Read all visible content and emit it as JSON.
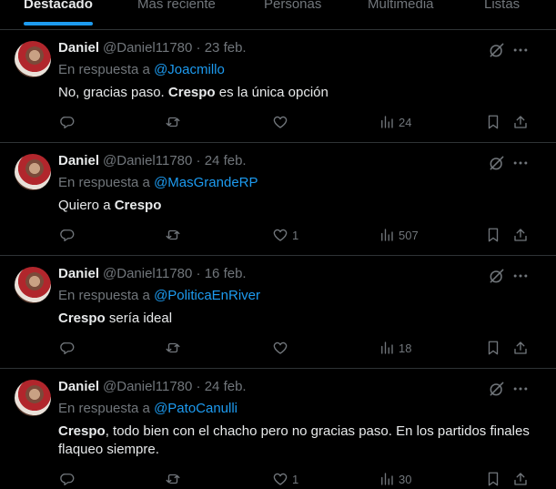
{
  "tabs": [
    {
      "label": "Destacado",
      "active": true
    },
    {
      "label": "Más reciente",
      "active": false
    },
    {
      "label": "Personas",
      "active": false
    },
    {
      "label": "Multimedia",
      "active": false
    },
    {
      "label": "Listas",
      "active": false
    }
  ],
  "reply_prefix": "En respuesta a",
  "tweets": [
    {
      "name": "Daniel",
      "handle": "@Daniel11780",
      "date": "23 feb.",
      "reply_to": "@Joacmillo",
      "text_parts": [
        "No, gracias paso. ",
        "Crespo",
        " es la única opción"
      ],
      "likes": "",
      "views": "24"
    },
    {
      "name": "Daniel",
      "handle": "@Daniel11780",
      "date": "24 feb.",
      "reply_to": "@MasGrandeRP",
      "text_parts": [
        "Quiero a ",
        "Crespo",
        ""
      ],
      "likes": "1",
      "views": "507"
    },
    {
      "name": "Daniel",
      "handle": "@Daniel11780",
      "date": "16 feb.",
      "reply_to": "@PoliticaEnRiver",
      "text_parts": [
        "",
        "Crespo",
        " sería ideal"
      ],
      "likes": "",
      "views": "18"
    },
    {
      "name": "Daniel",
      "handle": "@Daniel11780",
      "date": "24 feb.",
      "reply_to": "@PatoCanulli",
      "text_parts": [
        "",
        "Crespo",
        ", todo bien con el chacho pero no gracias paso. En los partidos finales flaqueo siempre."
      ],
      "likes": "1",
      "views": "30"
    }
  ],
  "colors": {
    "background": "#000000",
    "text": "#e7e9ea",
    "muted": "#71767b",
    "accent": "#1d9bf0",
    "divider": "#2f3336"
  },
  "icons": [
    "reply-icon",
    "retweet-icon",
    "like-icon",
    "views-icon",
    "bookmark-icon",
    "share-icon",
    "grok-icon",
    "more-icon"
  ]
}
